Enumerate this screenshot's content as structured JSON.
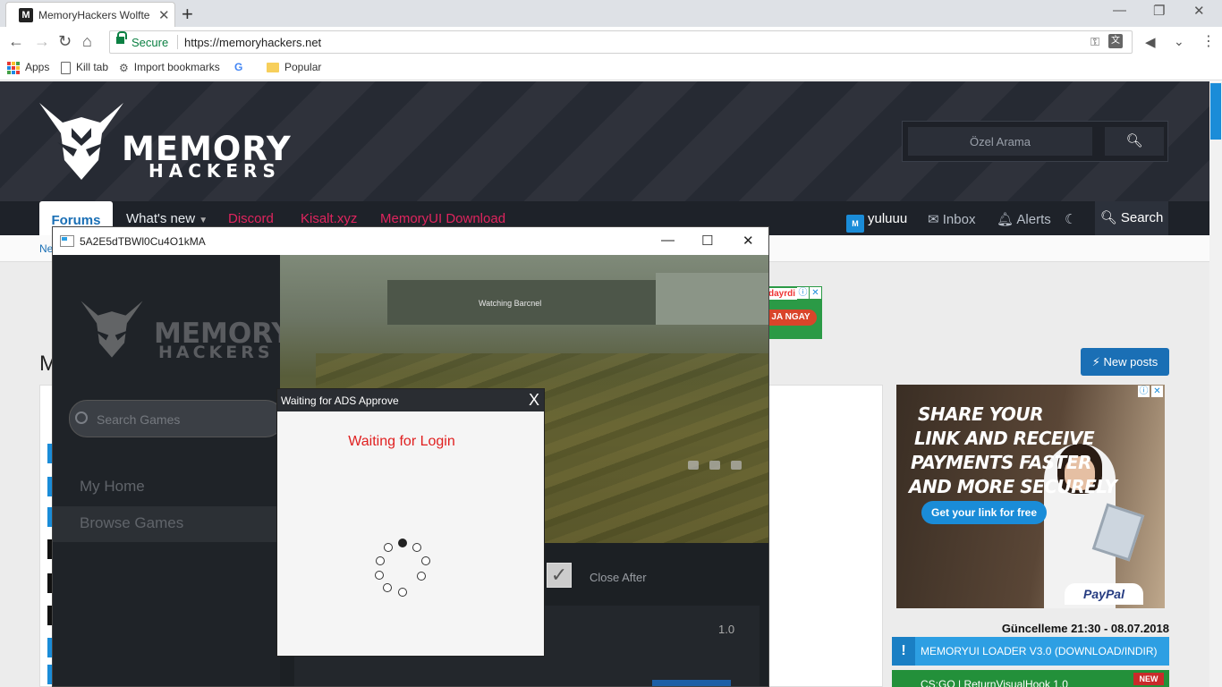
{
  "browser": {
    "tab_title": "MemoryHackers Wolfte",
    "tab_favicon": "M",
    "secure_label": "Secure",
    "url": "https://memoryhackers.net",
    "bookmarks": [
      "Apps",
      "Kill tab",
      "Import bookmarks",
      "Popular"
    ]
  },
  "site": {
    "logo_line1": "MEMORY",
    "logo_line2": "HACKERS",
    "search_placeholder": "Özel Arama",
    "nav": {
      "forums": "Forums",
      "whats_new": "What's new",
      "discord": "Discord",
      "kisalt": "Kisalt.xyz",
      "memoryui": "MemoryUI Download",
      "username": "yuluuu",
      "inbox": "Inbox",
      "alerts": "Alerts",
      "search": "Search"
    },
    "breadcrumb": "Ne",
    "page_title_fragment": "M",
    "new_posts": "New posts",
    "ad_top": {
      "text1": "dayrdi",
      "text2": "JA NGAY"
    },
    "ad_side": {
      "headline": [
        "SHARE YOUR",
        "LINK AND RECEIVE",
        "PAYMENTS FASTER",
        "AND MORE SECURELY"
      ],
      "cta": "Get your link for free",
      "brand": "PayPal"
    },
    "update_line": "Güncelleme 21:30 - 08.07.2018",
    "loader_link": "MEMORYUI LOADER V3.0 (DOWNLOAD/INDIR)",
    "csgo_link": "CS:GO | ReturnVisualHook 1.0",
    "new_badge": "NEW"
  },
  "app": {
    "window_title": "5A2E5dTBWl0Cu4O1kMA",
    "logo_line1": "MEMORY",
    "logo_line2": "HACKERS",
    "search_placeholder": "Search Games",
    "menu": [
      "My Home",
      "Browse Games"
    ],
    "game_caption": "Watching Barcnel",
    "close_after_label": "Close After",
    "close_after_checked": true,
    "version": "1.0"
  },
  "popup": {
    "title": "Waiting for ADS Approve",
    "close": "X",
    "status": "Waiting for Login",
    "status_color": "#e01f1f"
  },
  "colors": {
    "accent": "#1a6fb5",
    "nav_red": "#e0245e",
    "header_bg": "#262a33"
  }
}
